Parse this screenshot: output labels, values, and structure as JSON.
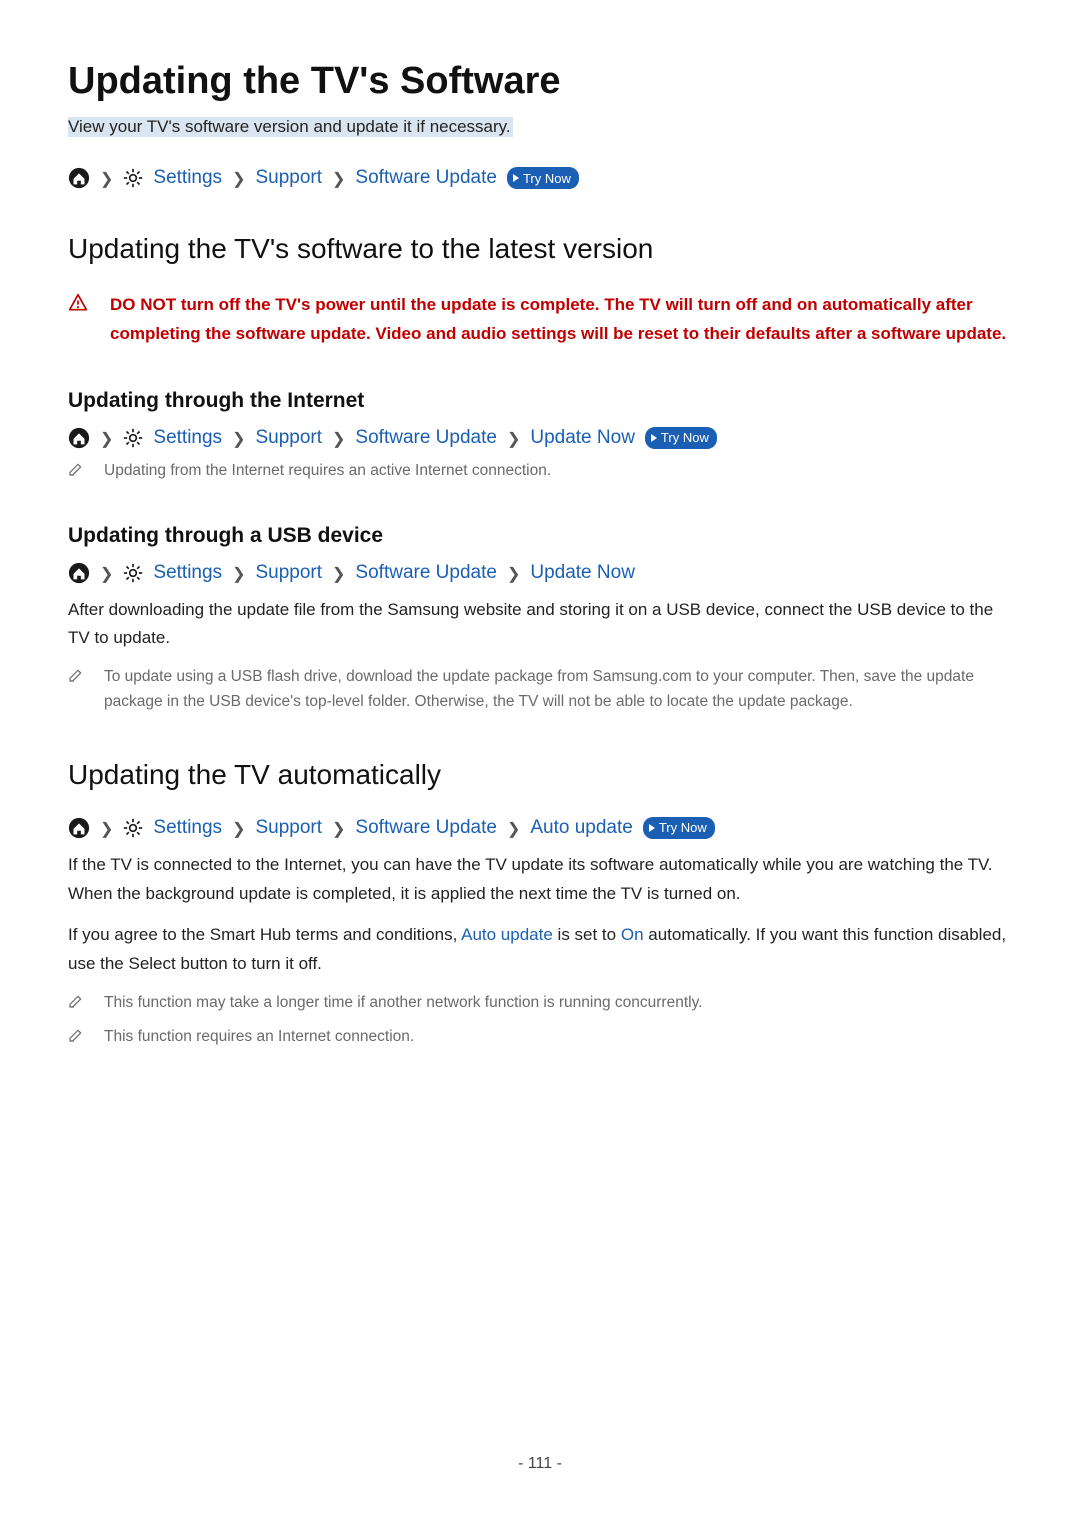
{
  "title": "Updating the TV's Software",
  "intro": "View your TV's software version and update it if necessary.",
  "breadcrumb_labels": {
    "settings": "Settings",
    "support": "Support",
    "software_update": "Software Update",
    "update_now": "Update Now",
    "auto_update": "Auto update"
  },
  "try_now": "Try Now",
  "section_latest": {
    "heading": "Updating the TV's software to the latest version",
    "warning": "DO NOT turn off the TV's power until the update is complete. The TV will turn off and on automatically after completing the software update. Video and audio settings will be reset to their defaults after a software update."
  },
  "subsection_internet": {
    "heading": "Updating through the Internet",
    "note": "Updating from the Internet requires an active Internet connection."
  },
  "subsection_usb": {
    "heading": "Updating through a USB device",
    "body": "After downloading the update file from the Samsung website and storing it on a USB device, connect the USB device to the TV to update.",
    "note": "To update using a USB flash drive, download the update package from Samsung.com to your computer. Then, save the update package in the USB device's top-level folder. Otherwise, the TV will not be able to locate the update package."
  },
  "section_auto": {
    "heading": "Updating the TV automatically",
    "body1": "If the TV is connected to the Internet, you can have the TV update its software automatically while you are watching the TV. When the background update is completed, it is applied the next time the TV is turned on.",
    "body2_pre": "If you agree to the Smart Hub terms and conditions, ",
    "body2_link1": "Auto update",
    "body2_mid": " is set to ",
    "body2_link2": "On",
    "body2_post": " automatically. If you want this function disabled, use the Select button to turn it off.",
    "note1": "This function may take a longer time if another network function is running concurrently.",
    "note2": "This function requires an Internet connection."
  },
  "page_number": "- 111 -"
}
